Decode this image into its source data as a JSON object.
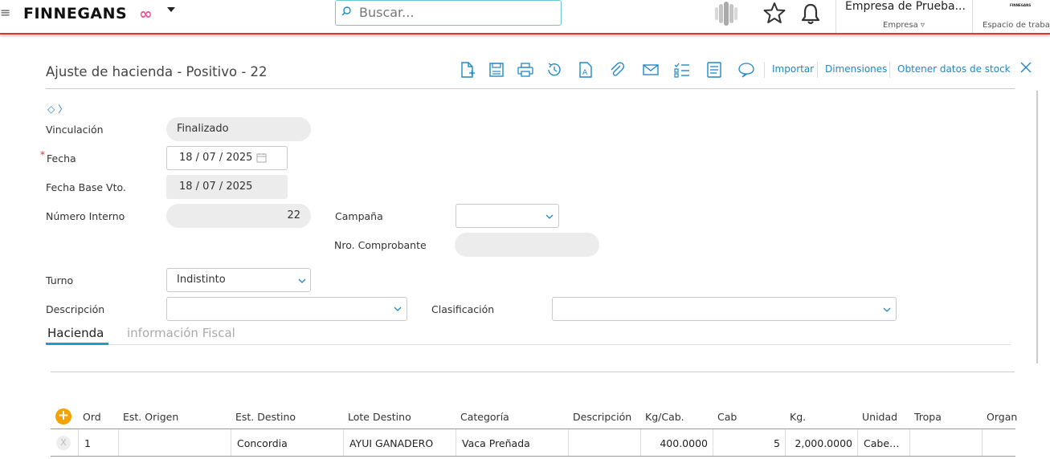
{
  "header": {
    "brand": "FINNEGANS",
    "search_placeholder": "Buscar...",
    "company_name": "Empresa de Prueba...",
    "company_label": "Empresa",
    "workspace_brand": "FINNEGANS",
    "workspace_label": "Espacio de trabajo"
  },
  "form": {
    "title": "Ajuste de hacienda - Positivo - 22",
    "toolbar_links": {
      "importar": "Importar",
      "dimensiones": "Dimensiones",
      "stock": "Obtener datos de stock"
    },
    "vinculacion": {
      "label": "Vinculación",
      "value": "Finalizado"
    },
    "fecha": {
      "label": "Fecha",
      "required_mark": "*",
      "value": "18 / 07 / 2025"
    },
    "fecha_base": {
      "label": "Fecha Base Vto.",
      "value": "18 / 07 / 2025"
    },
    "numero_interno": {
      "label": "Número Interno",
      "value": "22"
    },
    "campana": {
      "label": "Campaña",
      "value": ""
    },
    "nro_comprobante": {
      "label": "Nro. Comprobante",
      "value": ""
    },
    "turno": {
      "label": "Turno",
      "value": "Indistinto"
    },
    "descripcion": {
      "label": "Descripción",
      "value": ""
    },
    "clasificacion": {
      "label": "Clasificación",
      "value": ""
    }
  },
  "tabs": [
    {
      "label": "Hacienda",
      "active": true
    },
    {
      "label": "información Fiscal",
      "active": false
    }
  ],
  "grid": {
    "add_glyph": "+",
    "remove_glyph": "X",
    "columns": [
      "Ord",
      "Est. Origen",
      "Est. Destino",
      "Lote Destino",
      "Categoría",
      "Descripción",
      "Kg/Cab.",
      "Cab",
      "Kg.",
      "Unidad",
      "Tropa",
      "Organ"
    ],
    "rows": [
      [
        "1",
        "",
        "Concordia",
        "AYUI GANADERO",
        "Vaca Preñada",
        "",
        "400.0000",
        "5",
        "2,000.0000",
        "Cabe…",
        "",
        ""
      ]
    ]
  },
  "colors": {
    "accent": "#1e88c7",
    "brand_red": "#d63a2f",
    "add_button": "#f5a100"
  }
}
